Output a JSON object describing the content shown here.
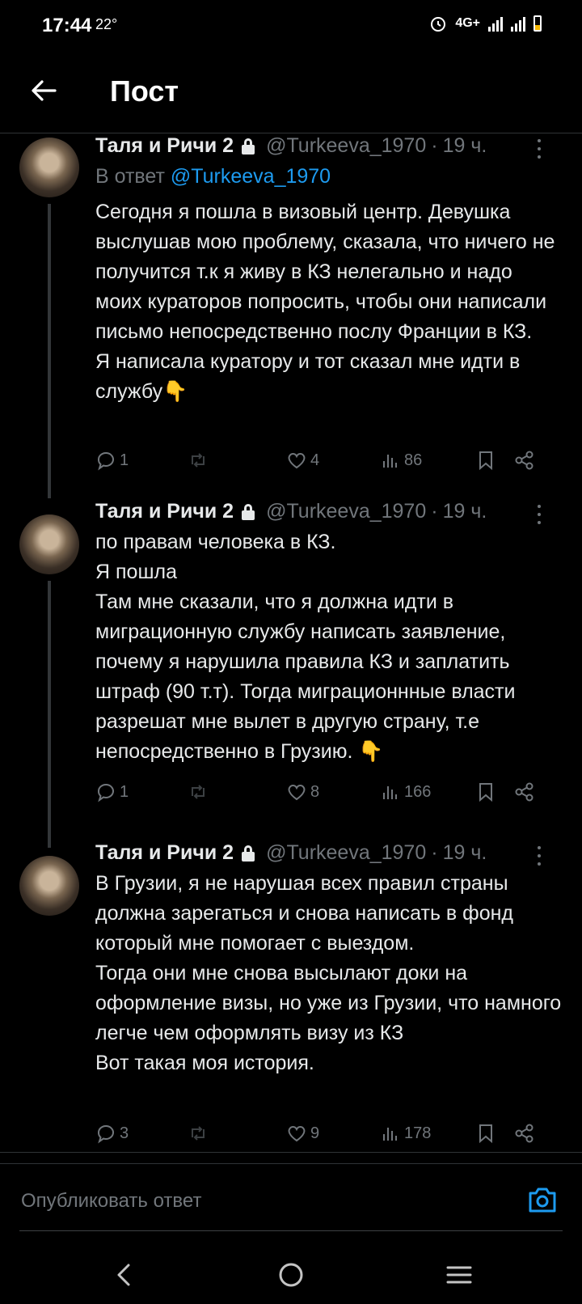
{
  "status_bar": {
    "time": "17:44",
    "temperature": "22°",
    "network": "4G+"
  },
  "header": {
    "title": "Пост",
    "back_icon": "arrow-left-icon"
  },
  "tweets": [
    {
      "name": "Таля и Ричи 2",
      "handle": "@Turkeeva_1970",
      "time": "19 ч.",
      "reply_prefix": "В ответ",
      "reply_to": "@Turkeeva_1970",
      "text": "Сегодня я пошла в визовый центр. Девушка выслушав мою проблему, сказала, что ничего не получится т.к я живу в КЗ нелегально и надо моих кураторов попросить, чтобы они написали письмо непосредственно послу Франции в КЗ.\nЯ написала куратору и тот сказал мне идти в службу👇",
      "replies": "1",
      "retweets": "",
      "likes": "4",
      "views": "86"
    },
    {
      "name": "Таля и Ричи 2",
      "handle": "@Turkeeva_1970",
      "time": "19 ч.",
      "text": "по правам человека в КЗ.\nЯ пошла\nТам мне сказали, что я должна идти в миграционную службу написать заявление, почему я нарушила правила КЗ и заплатить штраф (90 т.т). Тогда миграционнные власти разрешат мне вылет в другую страну, т.е непосредственно в Грузию. 👇",
      "replies": "1",
      "retweets": "",
      "likes": "8",
      "views": "166"
    },
    {
      "name": "Таля и Ричи 2",
      "handle": "@Turkeeva_1970",
      "time": "19 ч.",
      "text": "В Грузии, я не нарушая всех правил страны должна зарегаться и снова написать в фонд который мне помогает с выездом.\nТогда они мне снова высылают доки на оформление визы, но уже из Грузии, что намного легче чем оформлять визу из КЗ\nВот такая моя история.",
      "replies": "3",
      "retweets": "",
      "likes": "9",
      "views": "178"
    }
  ],
  "composer": {
    "placeholder": "Опубликовать ответ",
    "camera_icon": "camera-icon"
  },
  "nav": {
    "back": "nav-back-icon",
    "home": "nav-home-icon",
    "recents": "nav-recents-icon"
  },
  "colors": {
    "background": "#000000",
    "text": "#e7e9ea",
    "muted": "#71767b",
    "accent": "#1d9bf0",
    "divider": "#2f3336"
  }
}
